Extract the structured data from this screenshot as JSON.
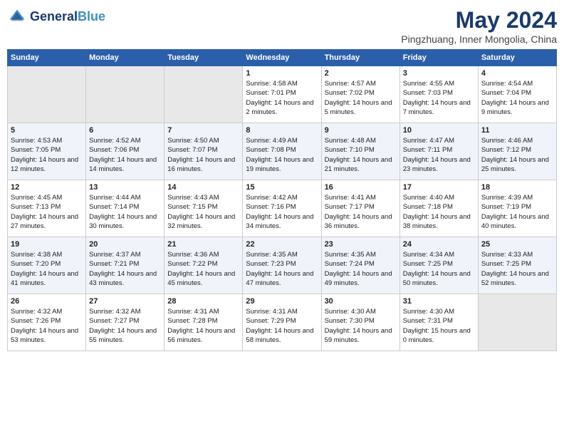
{
  "header": {
    "logo_line1": "General",
    "logo_line2": "Blue",
    "month": "May 2024",
    "location": "Pingzhuang, Inner Mongolia, China"
  },
  "days_of_week": [
    "Sunday",
    "Monday",
    "Tuesday",
    "Wednesday",
    "Thursday",
    "Friday",
    "Saturday"
  ],
  "weeks": [
    [
      {
        "day": "",
        "empty": true
      },
      {
        "day": "",
        "empty": true
      },
      {
        "day": "",
        "empty": true
      },
      {
        "day": "1",
        "sunrise": "4:58 AM",
        "sunset": "7:01 PM",
        "daylight": "14 hours and 2 minutes."
      },
      {
        "day": "2",
        "sunrise": "4:57 AM",
        "sunset": "7:02 PM",
        "daylight": "14 hours and 5 minutes."
      },
      {
        "day": "3",
        "sunrise": "4:55 AM",
        "sunset": "7:03 PM",
        "daylight": "14 hours and 7 minutes."
      },
      {
        "day": "4",
        "sunrise": "4:54 AM",
        "sunset": "7:04 PM",
        "daylight": "14 hours and 9 minutes."
      }
    ],
    [
      {
        "day": "5",
        "sunrise": "4:53 AM",
        "sunset": "7:05 PM",
        "daylight": "14 hours and 12 minutes."
      },
      {
        "day": "6",
        "sunrise": "4:52 AM",
        "sunset": "7:06 PM",
        "daylight": "14 hours and 14 minutes."
      },
      {
        "day": "7",
        "sunrise": "4:50 AM",
        "sunset": "7:07 PM",
        "daylight": "14 hours and 16 minutes."
      },
      {
        "day": "8",
        "sunrise": "4:49 AM",
        "sunset": "7:08 PM",
        "daylight": "14 hours and 19 minutes."
      },
      {
        "day": "9",
        "sunrise": "4:48 AM",
        "sunset": "7:10 PM",
        "daylight": "14 hours and 21 minutes."
      },
      {
        "day": "10",
        "sunrise": "4:47 AM",
        "sunset": "7:11 PM",
        "daylight": "14 hours and 23 minutes."
      },
      {
        "day": "11",
        "sunrise": "4:46 AM",
        "sunset": "7:12 PM",
        "daylight": "14 hours and 25 minutes."
      }
    ],
    [
      {
        "day": "12",
        "sunrise": "4:45 AM",
        "sunset": "7:13 PM",
        "daylight": "14 hours and 27 minutes."
      },
      {
        "day": "13",
        "sunrise": "4:44 AM",
        "sunset": "7:14 PM",
        "daylight": "14 hours and 30 minutes."
      },
      {
        "day": "14",
        "sunrise": "4:43 AM",
        "sunset": "7:15 PM",
        "daylight": "14 hours and 32 minutes."
      },
      {
        "day": "15",
        "sunrise": "4:42 AM",
        "sunset": "7:16 PM",
        "daylight": "14 hours and 34 minutes."
      },
      {
        "day": "16",
        "sunrise": "4:41 AM",
        "sunset": "7:17 PM",
        "daylight": "14 hours and 36 minutes."
      },
      {
        "day": "17",
        "sunrise": "4:40 AM",
        "sunset": "7:18 PM",
        "daylight": "14 hours and 38 minutes."
      },
      {
        "day": "18",
        "sunrise": "4:39 AM",
        "sunset": "7:19 PM",
        "daylight": "14 hours and 40 minutes."
      }
    ],
    [
      {
        "day": "19",
        "sunrise": "4:38 AM",
        "sunset": "7:20 PM",
        "daylight": "14 hours and 41 minutes."
      },
      {
        "day": "20",
        "sunrise": "4:37 AM",
        "sunset": "7:21 PM",
        "daylight": "14 hours and 43 minutes."
      },
      {
        "day": "21",
        "sunrise": "4:36 AM",
        "sunset": "7:22 PM",
        "daylight": "14 hours and 45 minutes."
      },
      {
        "day": "22",
        "sunrise": "4:35 AM",
        "sunset": "7:23 PM",
        "daylight": "14 hours and 47 minutes."
      },
      {
        "day": "23",
        "sunrise": "4:35 AM",
        "sunset": "7:24 PM",
        "daylight": "14 hours and 49 minutes."
      },
      {
        "day": "24",
        "sunrise": "4:34 AM",
        "sunset": "7:25 PM",
        "daylight": "14 hours and 50 minutes."
      },
      {
        "day": "25",
        "sunrise": "4:33 AM",
        "sunset": "7:25 PM",
        "daylight": "14 hours and 52 minutes."
      }
    ],
    [
      {
        "day": "26",
        "sunrise": "4:32 AM",
        "sunset": "7:26 PM",
        "daylight": "14 hours and 53 minutes."
      },
      {
        "day": "27",
        "sunrise": "4:32 AM",
        "sunset": "7:27 PM",
        "daylight": "14 hours and 55 minutes."
      },
      {
        "day": "28",
        "sunrise": "4:31 AM",
        "sunset": "7:28 PM",
        "daylight": "14 hours and 56 minutes."
      },
      {
        "day": "29",
        "sunrise": "4:31 AM",
        "sunset": "7:29 PM",
        "daylight": "14 hours and 58 minutes."
      },
      {
        "day": "30",
        "sunrise": "4:30 AM",
        "sunset": "7:30 PM",
        "daylight": "14 hours and 59 minutes."
      },
      {
        "day": "31",
        "sunrise": "4:30 AM",
        "sunset": "7:31 PM",
        "daylight": "15 hours and 0 minutes."
      },
      {
        "day": "",
        "empty": true
      }
    ]
  ]
}
